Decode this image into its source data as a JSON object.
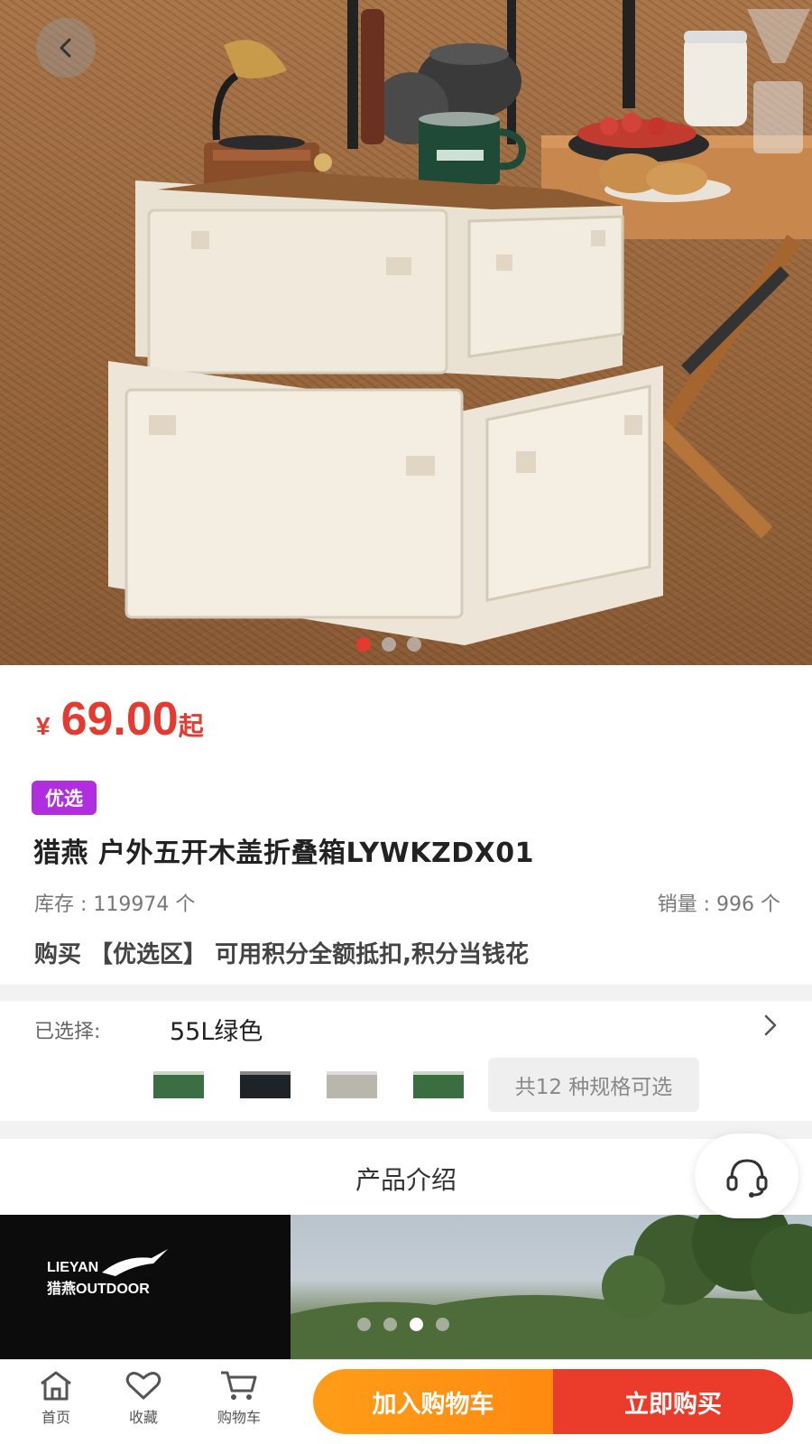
{
  "hero": {
    "image_desc_icon": "product-photo",
    "slide_count": 3,
    "active_slide": 1
  },
  "price": {
    "symbol": "¥",
    "amount": "69.00",
    "suffix": "起"
  },
  "tag": "优选",
  "product": {
    "title": "猎燕 户外五开木盖折叠箱LYWKZDX01",
    "stock": "库存 : 119974 个",
    "sales": "销量 : 996 个",
    "promo": "购买 【优选区】 可用积分全额抵扣,积分当钱花"
  },
  "spec": {
    "label": "已选择:",
    "value": "55L绿色",
    "count_text": "共12 种规格可选",
    "thumbnails": [
      {
        "color": "#3b6e42"
      },
      {
        "color": "#1e2328"
      },
      {
        "color": "#b9b6ae"
      },
      {
        "color": "#3a6d40"
      }
    ]
  },
  "intro": {
    "title": "产品介绍"
  },
  "banner": {
    "brand_line1": "LIEYAN",
    "brand_line2": "猎燕OUTDOOR",
    "dot_count": 4,
    "active_dot": 3
  },
  "bottom_nav": {
    "home": "首页",
    "favorite": "收藏",
    "cart": "购物车",
    "add_to_cart": "加入购物车",
    "buy_now": "立即购买"
  },
  "colors": {
    "price_red": "#e53a2f",
    "tag_purple": "#b02ee0",
    "cart_orange": "#ff9d17",
    "buy_red": "#ea3b2b"
  }
}
